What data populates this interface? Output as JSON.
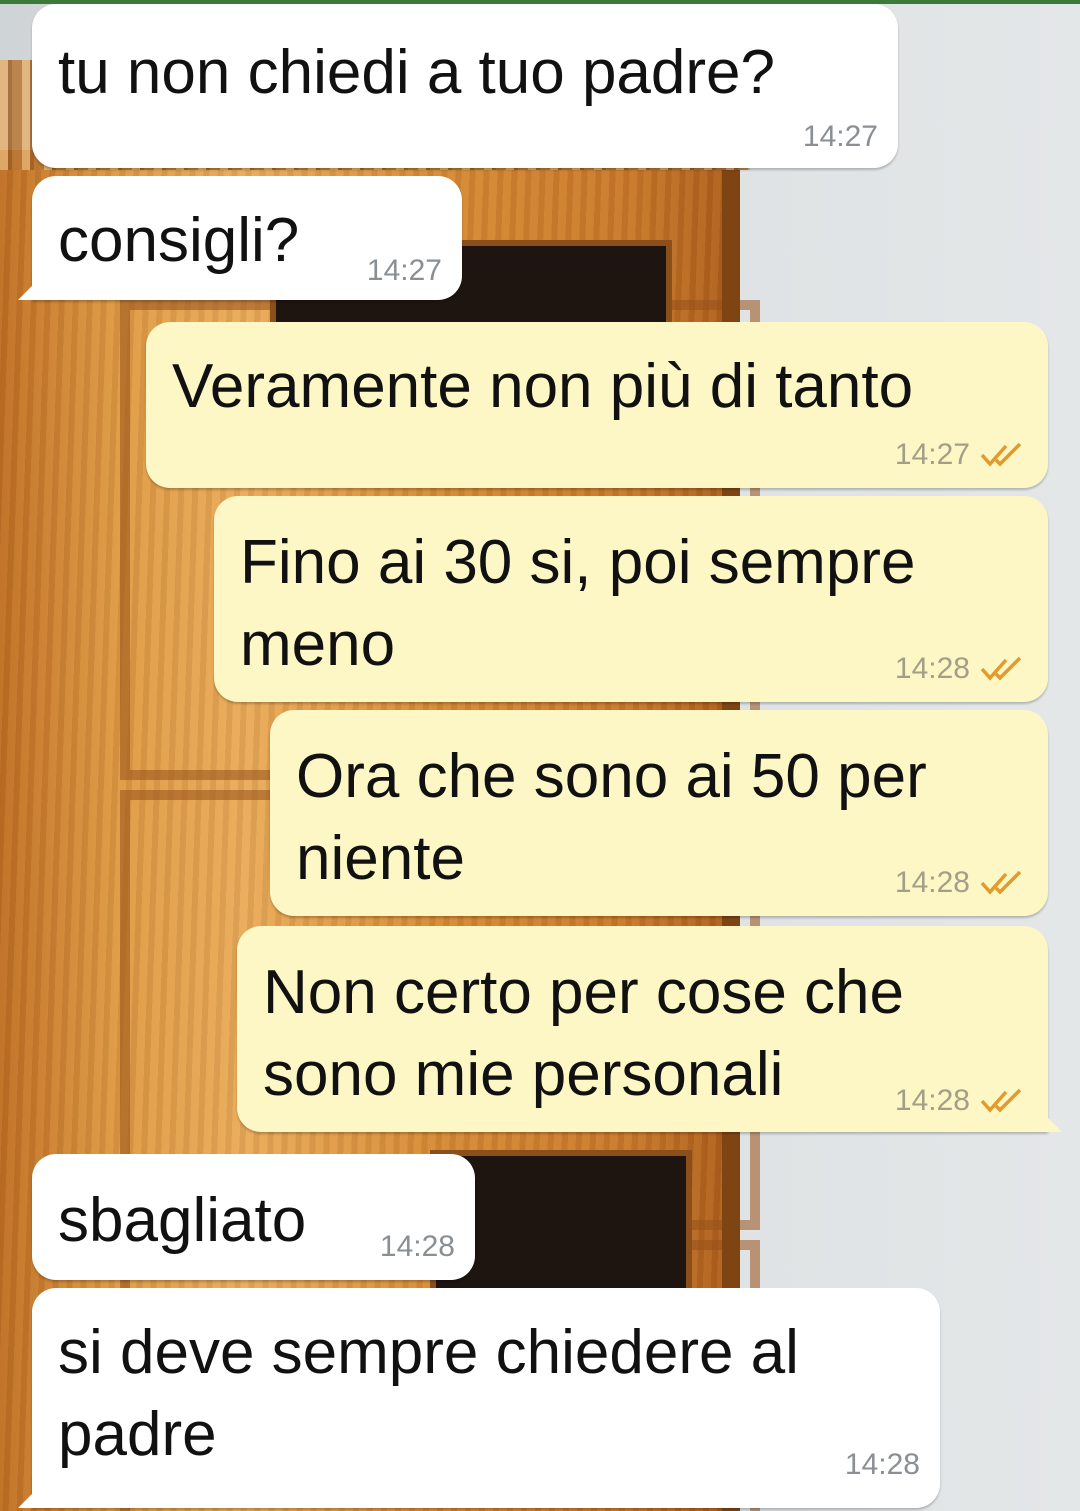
{
  "messages": [
    {
      "direction": "in",
      "text_lines": [
        "tu non chiedi a tuo padre?"
      ],
      "time": "14:27"
    },
    {
      "direction": "in",
      "text_lines": [
        "consigli?"
      ],
      "time": "14:27"
    },
    {
      "direction": "out",
      "text_lines": [
        "Veramente non più di tanto"
      ],
      "time": "14:27",
      "status": "read"
    },
    {
      "direction": "out",
      "text_lines": [
        "Fino ai 30 si, poi sempre",
        "meno"
      ],
      "time": "14:28",
      "status": "read"
    },
    {
      "direction": "out",
      "text_lines": [
        "Ora che sono ai 50 per",
        "niente"
      ],
      "time": "14:28",
      "status": "read"
    },
    {
      "direction": "out",
      "text_lines": [
        "Non certo per cose che",
        "sono mie personali"
      ],
      "time": "14:28",
      "status": "read"
    },
    {
      "direction": "in",
      "text_lines": [
        "sbagliato"
      ],
      "time": "14:28"
    },
    {
      "direction": "in",
      "text_lines": [
        "si deve sempre chiedere al",
        "padre"
      ],
      "time": "14:28"
    }
  ],
  "colors": {
    "incoming_bubble": "#ffffff",
    "outgoing_bubble": "#fdf7c6",
    "read_ticks": "#e39a2b",
    "timestamp": "#8a8f93"
  },
  "icons": {
    "read_receipt": "double-check-icon"
  }
}
